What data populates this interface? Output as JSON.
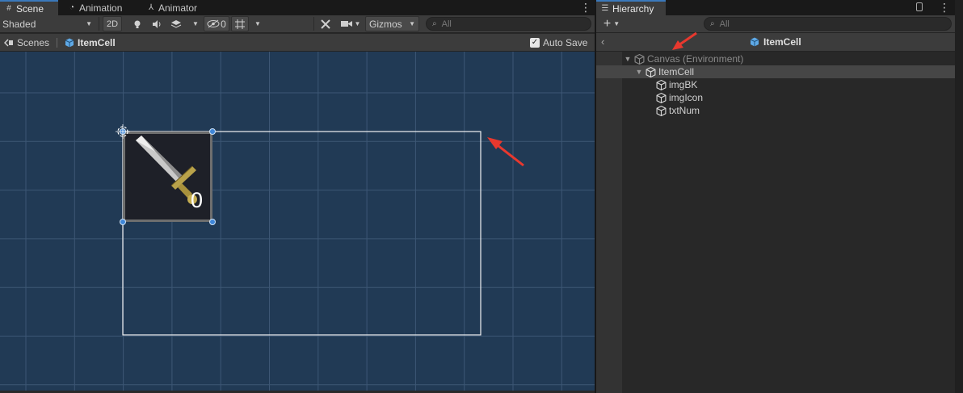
{
  "scene": {
    "tabs": [
      {
        "label": "Scene",
        "icon": "grid-icon"
      },
      {
        "label": "Animation",
        "icon": "clock-icon"
      },
      {
        "label": "Animator",
        "icon": "animator-icon"
      }
    ],
    "toolbar": {
      "shading_mode": "Shaded",
      "mode_2d": "2D",
      "hidden_count": "0",
      "gizmos_label": "Gizmos",
      "search_placeholder": "All"
    },
    "breadcrumb": {
      "scenes_label": "Scenes",
      "prefab_name": "ItemCell",
      "auto_save_label": "Auto Save",
      "auto_save_checked": true
    },
    "item_count_text": "0",
    "colors": {
      "viewport_bg": "#213a55",
      "grid_line": "#3d5775",
      "rect_outline": "#f2f2f2",
      "handle": "#3f86d8",
      "annotation_arrow": "#e8382e",
      "accent": "#3a79bb"
    }
  },
  "hierarchy": {
    "tab_label": "Hierarchy",
    "tab_icon": "list-icon",
    "search_placeholder": "All",
    "header_title": "ItemCell",
    "tree": [
      {
        "label": "Canvas (Environment)",
        "depth": 0,
        "expanded": true,
        "dimmed": true
      },
      {
        "label": "ItemCell",
        "depth": 1,
        "expanded": true,
        "selected": true
      },
      {
        "label": "imgBK",
        "depth": 2
      },
      {
        "label": "imgIcon",
        "depth": 2
      },
      {
        "label": "txtNum",
        "depth": 2
      }
    ]
  }
}
